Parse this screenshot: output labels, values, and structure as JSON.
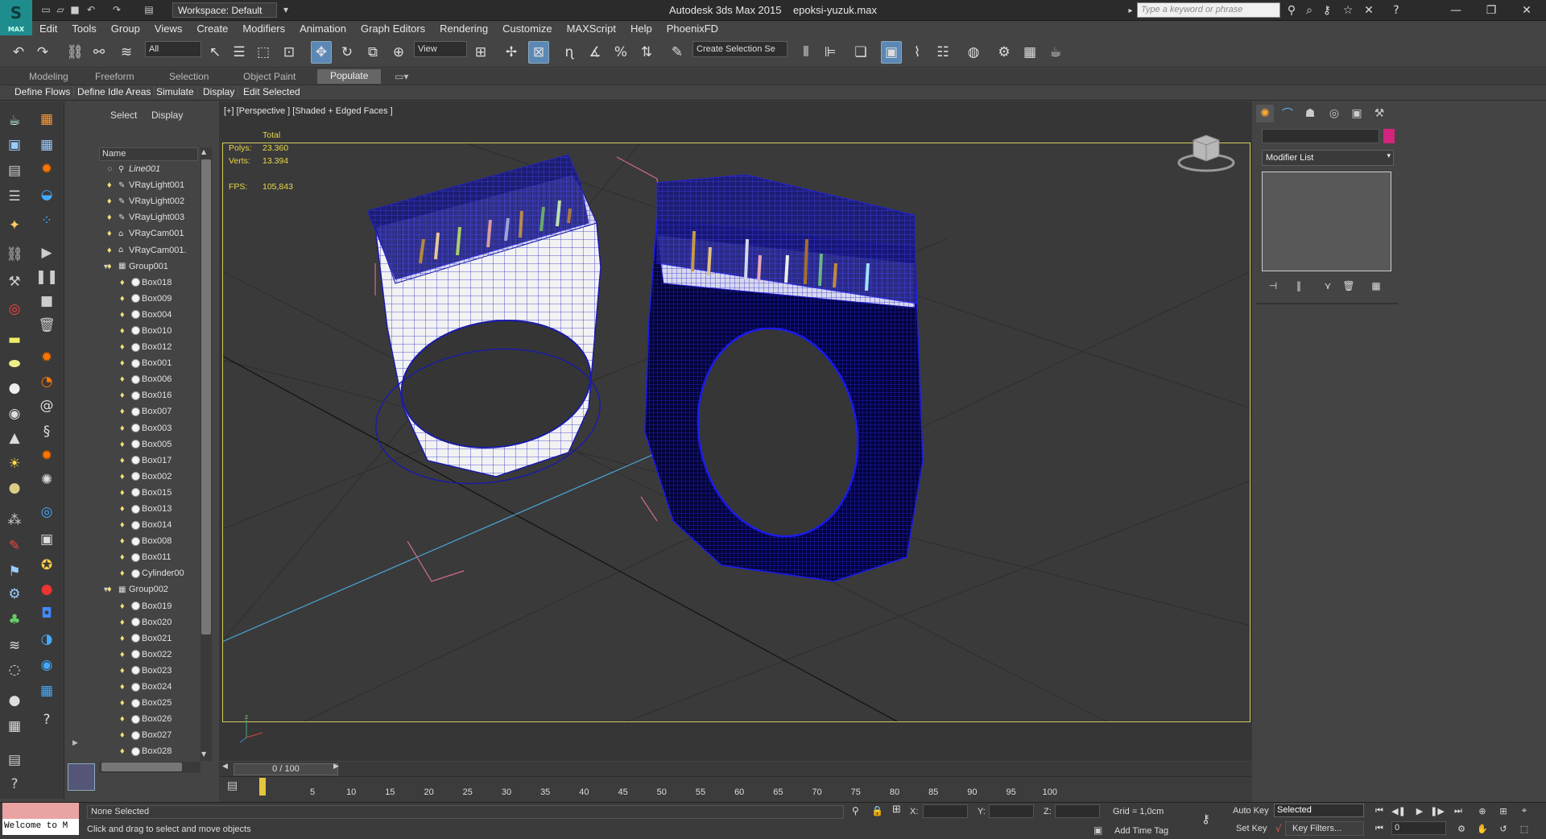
{
  "app": {
    "title": "Autodesk 3ds Max  2015",
    "filename": "epoksi-yuzuk.max",
    "workspace": "Workspace: Default",
    "search_placeholder": "Type a keyword or phrase",
    "logo_text": "MAX"
  },
  "menu": [
    "Edit",
    "Tools",
    "Group",
    "Views",
    "Create",
    "Modifiers",
    "Animation",
    "Graph Editors",
    "Rendering",
    "Customize",
    "MAXScript",
    "Help",
    "PhoenixFD"
  ],
  "toolbar": {
    "selection_filter": "All",
    "ref_coord": "View",
    "named_selection": "Create Selection Se"
  },
  "ribbon": {
    "tabs": [
      "Modeling",
      "Freeform",
      "Selection",
      "Object Paint",
      "Populate"
    ],
    "active_tab": "Populate",
    "sub_items": [
      "Define Flows",
      "Define Idle Areas",
      "Simulate",
      "Display",
      "Edit Selected"
    ]
  },
  "explorer": {
    "tabs": [
      "Select",
      "Display"
    ],
    "column": "Name",
    "items": [
      {
        "name": "Line001",
        "level": 0,
        "icon": "line",
        "italic": true
      },
      {
        "name": "VRayLight001",
        "level": 0,
        "icon": "light"
      },
      {
        "name": "VRayLight002",
        "level": 0,
        "icon": "light"
      },
      {
        "name": "VRayLight003",
        "level": 0,
        "icon": "light"
      },
      {
        "name": "VRayCam001",
        "level": 0,
        "icon": "camera"
      },
      {
        "name": "VRayCam001.",
        "level": 0,
        "icon": "camera"
      },
      {
        "name": "Group001",
        "level": 0,
        "icon": "group",
        "expanded": true
      },
      {
        "name": "Box018",
        "level": 1,
        "icon": "object"
      },
      {
        "name": "Box009",
        "level": 1,
        "icon": "object"
      },
      {
        "name": "Box004",
        "level": 1,
        "icon": "object"
      },
      {
        "name": "Box010",
        "level": 1,
        "icon": "object"
      },
      {
        "name": "Box012",
        "level": 1,
        "icon": "object"
      },
      {
        "name": "Box001",
        "level": 1,
        "icon": "object"
      },
      {
        "name": "Box006",
        "level": 1,
        "icon": "object"
      },
      {
        "name": "Box016",
        "level": 1,
        "icon": "object"
      },
      {
        "name": "Box007",
        "level": 1,
        "icon": "object"
      },
      {
        "name": "Box003",
        "level": 1,
        "icon": "object"
      },
      {
        "name": "Box005",
        "level": 1,
        "icon": "object"
      },
      {
        "name": "Box017",
        "level": 1,
        "icon": "object"
      },
      {
        "name": "Box002",
        "level": 1,
        "icon": "object"
      },
      {
        "name": "Box015",
        "level": 1,
        "icon": "object"
      },
      {
        "name": "Box013",
        "level": 1,
        "icon": "object"
      },
      {
        "name": "Box014",
        "level": 1,
        "icon": "object"
      },
      {
        "name": "Box008",
        "level": 1,
        "icon": "object"
      },
      {
        "name": "Box011",
        "level": 1,
        "icon": "object"
      },
      {
        "name": "Cylinder00",
        "level": 1,
        "icon": "object"
      },
      {
        "name": "Group002",
        "level": 0,
        "icon": "group",
        "expanded": true
      },
      {
        "name": "Box019",
        "level": 1,
        "icon": "object"
      },
      {
        "name": "Box020",
        "level": 1,
        "icon": "object"
      },
      {
        "name": "Box021",
        "level": 1,
        "icon": "object"
      },
      {
        "name": "Box022",
        "level": 1,
        "icon": "object"
      },
      {
        "name": "Box023",
        "level": 1,
        "icon": "object"
      },
      {
        "name": "Box024",
        "level": 1,
        "icon": "object"
      },
      {
        "name": "Box025",
        "level": 1,
        "icon": "object"
      },
      {
        "name": "Box026",
        "level": 1,
        "icon": "object"
      },
      {
        "name": "Box027",
        "level": 1,
        "icon": "object"
      },
      {
        "name": "Box028",
        "level": 1,
        "icon": "object"
      }
    ]
  },
  "viewport": {
    "label": "[+] [Perspective ] [Shaded + Edged Faces ]",
    "stats_header": "Total",
    "polys_label": "Polys:",
    "polys": "23.360",
    "verts_label": "Verts:",
    "verts": "13.394",
    "fps_label": "FPS:",
    "fps": "105,843"
  },
  "timeline": {
    "slider": "0 / 100",
    "ticks": [
      "5",
      "10",
      "15",
      "20",
      "25",
      "30",
      "35",
      "40",
      "45",
      "50",
      "55",
      "60",
      "65",
      "70",
      "75",
      "80",
      "85",
      "90",
      "95",
      "100"
    ]
  },
  "command_panel": {
    "modifier_list": "Modifier List",
    "object_color": "#d4247d"
  },
  "status": {
    "maxscript": "Welcome to M",
    "selection": "None Selected",
    "prompt": "Click and drag to select and move objects",
    "x_label": "X:",
    "y_label": "Y:",
    "z_label": "Z:",
    "grid": "Grid = 1,0cm",
    "add_time_tag": "Add Time Tag",
    "auto_key": "Auto Key",
    "set_key": "Set Key",
    "selected": "Selected",
    "key_filters": "Key Filters...",
    "frame": "0"
  },
  "colors": {
    "accent": "#5b88b5",
    "viewport_border": "#d6cc5a",
    "stats": "#e9d84a",
    "wire": "#1a1acc"
  }
}
